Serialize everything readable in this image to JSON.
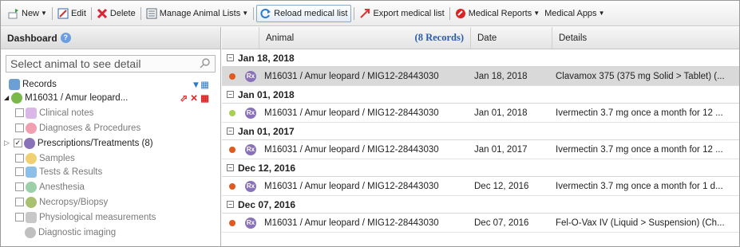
{
  "toolbar": {
    "new": "New",
    "edit": "Edit",
    "delete": "Delete",
    "manage": "Manage Animal Lists",
    "reload": "Reload medical list",
    "export": "Export medical list",
    "reports": "Medical Reports",
    "apps": "Medical Apps"
  },
  "sidebar": {
    "title": "Dashboard",
    "search_placeholder": "Select animal to see detail",
    "records": "Records",
    "animal": "M16031 / Amur leopard...",
    "items": [
      {
        "label": "Clinical notes",
        "color": "#d9b8e8"
      },
      {
        "label": "Diagnoses & Procedures",
        "color": "#f0a0b0"
      },
      {
        "label": "Prescriptions/Treatments (8)",
        "color": "#8a72b8"
      },
      {
        "label": "Samples",
        "color": "#f0d070"
      },
      {
        "label": "Tests & Results",
        "color": "#8cc0e8"
      },
      {
        "label": "Anesthesia",
        "color": "#9cd0a8"
      },
      {
        "label": "Necropsy/Biopsy",
        "color": "#a8c070"
      },
      {
        "label": "Physiological measurements",
        "color": "#c8c8c8"
      },
      {
        "label": "Diagnostic imaging",
        "color": "#c0c0c0"
      }
    ]
  },
  "grid": {
    "col_animal": "Animal",
    "records": "(8 Records)",
    "col_date": "Date",
    "col_details": "Details",
    "groups": [
      {
        "title": "Jan 18, 2018",
        "animal": "M16031 / Amur leopard / MIG12-28443030",
        "date": "Jan 18, 2018",
        "details": "Clavamox 375 (375 mg Solid > Tablet) (...",
        "status": "#e05a20"
      },
      {
        "title": "Jan 01, 2018",
        "animal": "M16031 / Amur leopard / MIG12-28443030",
        "date": "Jan 01, 2018",
        "details": "Ivermectin 3.7 mg once a month for 12 ...",
        "status": "#a8d050"
      },
      {
        "title": "Jan 01, 2017",
        "animal": "M16031 / Amur leopard / MIG12-28443030",
        "date": "Jan 01, 2017",
        "details": "Ivermectin 3.7 mg once a month for 12 ...",
        "status": "#e05a20"
      },
      {
        "title": "Dec 12, 2016",
        "animal": "M16031 / Amur leopard / MIG12-28443030",
        "date": "Dec 12, 2016",
        "details": "Ivermectin 3.7 mg once a month for 1 d...",
        "status": "#e05a20"
      },
      {
        "title": "Dec 07, 2016",
        "animal": "M16031 / Amur leopard / MIG12-28443030",
        "date": "Dec 07, 2016",
        "details": "Fel-O-Vax IV (Liquid > Suspension) (Ch...",
        "status": "#e05a20"
      }
    ]
  }
}
